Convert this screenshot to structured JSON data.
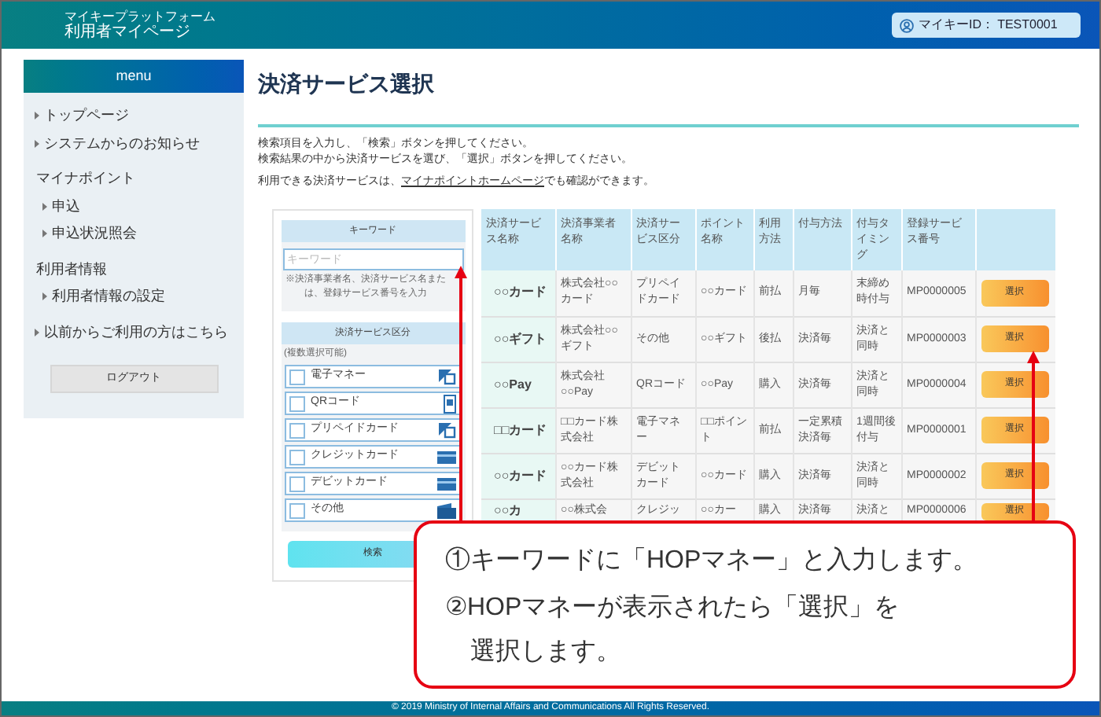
{
  "header": {
    "brand_line1": "マイキープラットフォーム",
    "brand_line2": "利用者マイページ",
    "user_id": "マイキーID： TEST0001"
  },
  "sidebar": {
    "title": "menu",
    "items": [
      {
        "kind": "link",
        "label": "トップページ"
      },
      {
        "kind": "link",
        "label": "システムからのお知らせ"
      },
      {
        "kind": "heading",
        "label": "マイナポイント",
        "children": [
          {
            "label": "申込"
          },
          {
            "label": "申込状況照会"
          }
        ]
      },
      {
        "kind": "heading",
        "label": "利用者情報",
        "children": [
          {
            "label": "利用者情報の設定"
          }
        ]
      },
      {
        "kind": "link",
        "label": "以前からご利用の方はこちら"
      }
    ],
    "logout_button": "ログアウト"
  },
  "main": {
    "title": "決済サービス選択",
    "instructions": [
      "検索項目を入力し、「検索」ボタンを押してください。",
      "検索結果の中から決済サービスを選び、「選択」ボタンを押してください。"
    ],
    "note": {
      "before": "利用できる決済サービスは、",
      "link": "マイナポイントホームページ",
      "after": "でも確認ができます。"
    }
  },
  "search": {
    "keyword_header": "キーワード",
    "keyword_placeholder": "キーワード",
    "keyword_hint": "※決済事業者名、決済サービス名または、登録サービス番号を入力",
    "category_header": "決済サービス区分",
    "category_hint": "(複数選択可能)",
    "categories": [
      {
        "label": "電子マネー",
        "checked": false,
        "kind": "emoney"
      },
      {
        "label": "QRコード",
        "checked": false,
        "kind": "qr"
      },
      {
        "label": "プリペイドカード",
        "checked": false,
        "kind": "emoney"
      },
      {
        "label": "クレジットカード",
        "checked": false,
        "kind": "card"
      },
      {
        "label": "デビットカード",
        "checked": false,
        "kind": "card"
      },
      {
        "label": "その他",
        "checked": false,
        "kind": "wallet"
      }
    ],
    "search_button": "検索"
  },
  "table": {
    "columns": [
      "決済サービス名称",
      "決済事業者名称",
      "決済サービス区分",
      "ポイント名称",
      "利用方法",
      "付与方法",
      "付与タイミング",
      "登録サービス番号"
    ],
    "rows": [
      {
        "cells": [
          "○○カード",
          "株式会社○○カード",
          "プリペイドカード",
          "○○カード",
          "前払",
          "月毎",
          "末締め時付与",
          "MP0000005"
        ],
        "action": "選択"
      },
      {
        "cells": [
          "○○ギフト",
          "株式会社○○ギフト",
          "その他",
          "○○ギフト",
          "後払",
          "決済毎",
          "決済と同時",
          "MP0000003"
        ],
        "action": "選択"
      },
      {
        "cells": [
          "○○Pay",
          "株式会社○○Pay",
          "QRコード",
          "○○Pay",
          "購入",
          "決済毎",
          "決済と同時",
          "MP0000004"
        ],
        "action": "選択"
      },
      {
        "cells": [
          "□□カード",
          "□□カード株式会社",
          "電子マネー",
          "□□ポイント",
          "前払",
          "一定累積決済毎",
          "1週間後付与",
          "MP0000001"
        ],
        "action": "選択"
      },
      {
        "cells": [
          "○○カード",
          "○○カード株式会社",
          "デビットカード",
          "○○カード",
          "購入",
          "決済毎",
          "決済と同時",
          "MP0000002"
        ],
        "action": "選択"
      },
      {
        "cells": [
          "○○カ",
          "○○株式会",
          "クレジッ",
          "○○カー",
          "購入",
          "決済毎",
          "決済と",
          "MP0000006"
        ],
        "action": "選択"
      }
    ]
  },
  "callout": {
    "steps": [
      "①キーワードに「HOPマネー」と入力します。",
      "②HOPマネーが表示されたら「選択」を選択します。"
    ]
  },
  "footer": {
    "copyright": "© 2019 Ministry of Internal Affairs and Communications All Rights Reserved."
  }
}
